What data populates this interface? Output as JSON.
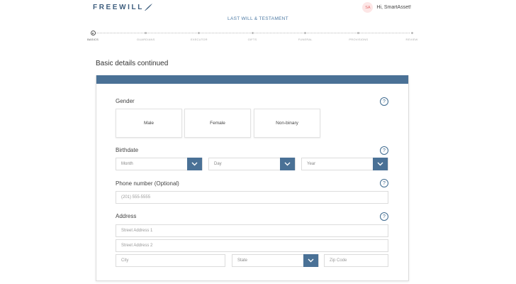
{
  "header": {
    "logo_text": "FREEWILL",
    "avatar_initials": "SA",
    "greeting": "Hi, SmartAsset!"
  },
  "document_title": "LAST WILL & TESTAMENT",
  "stepper": {
    "steps": [
      {
        "label": "BASICS",
        "active": true
      },
      {
        "label": "GUARDIANS",
        "active": false
      },
      {
        "label": "EXECUTOR",
        "active": false
      },
      {
        "label": "GIFTS",
        "active": false
      },
      {
        "label": "FUNERAL",
        "active": false
      },
      {
        "label": "PROVISIONS",
        "active": false
      },
      {
        "label": "REVIEW",
        "active": false
      }
    ]
  },
  "form": {
    "section_title": "Basic details continued",
    "help_glyph": "?",
    "gender": {
      "label": "Gender",
      "options": [
        "Male",
        "Female",
        "Non-binary"
      ]
    },
    "birthdate": {
      "label": "Birthdate",
      "month": "Month",
      "day": "Day",
      "year": "Year"
    },
    "phone": {
      "label": "Phone number (Optional)",
      "placeholder": "(201) 555-5555"
    },
    "address": {
      "label": "Address",
      "street1": "Street Address 1",
      "street2": "Street Address 2",
      "city": "City",
      "state": "State",
      "zip": "Zip Code"
    }
  },
  "colors": {
    "brand": "#3e5e7e",
    "accent": "#4a7196",
    "link": "#4d7aa4"
  }
}
